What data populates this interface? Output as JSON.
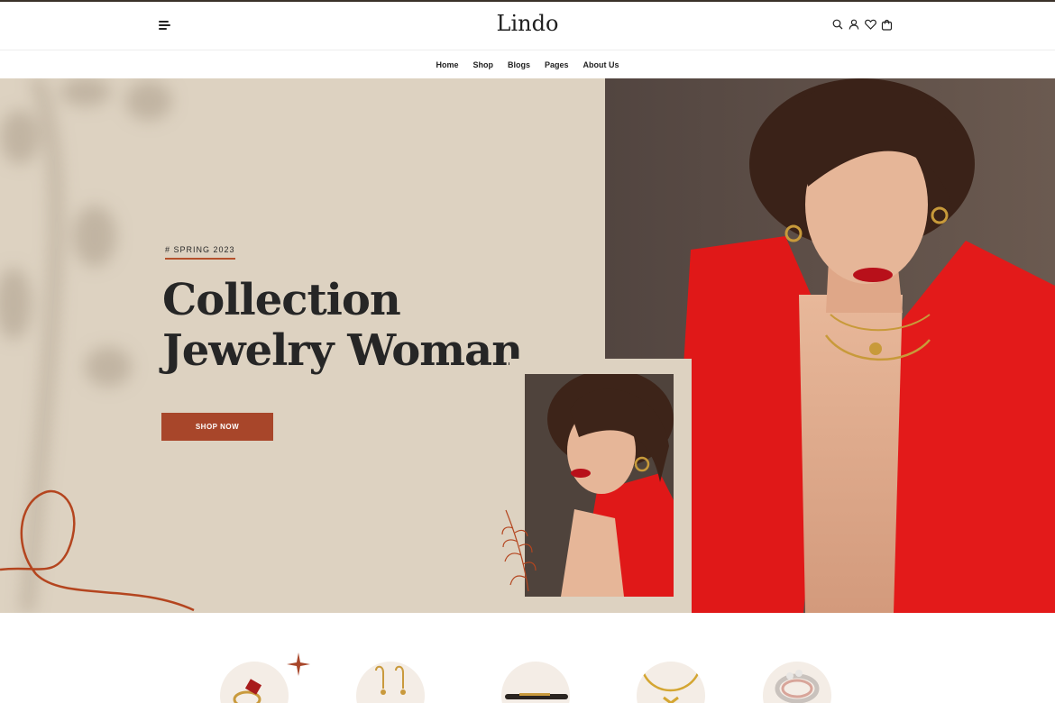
{
  "header": {
    "logo": "Lindo",
    "icons": [
      "menu-icon",
      "search-icon",
      "user-icon",
      "heart-icon",
      "cart-icon"
    ]
  },
  "nav": {
    "items": [
      {
        "label": "Home"
      },
      {
        "label": "Shop"
      },
      {
        "label": "Blogs"
      },
      {
        "label": "Pages"
      },
      {
        "label": "About Us"
      }
    ]
  },
  "hero": {
    "tag": "# SPRING 2023",
    "headline_line1": "Collection",
    "headline_line2": "Jewelry Woman",
    "cta": "SHOP NOW"
  },
  "categories": {
    "items": [
      "ring-icon",
      "earring-icon",
      "bracelet-icon",
      "necklace-icon",
      "diamond-ring-icon"
    ]
  },
  "colors": {
    "accent": "#a8462a",
    "hero_bg": "#ddd2c1",
    "model_dress": "#e01818"
  }
}
